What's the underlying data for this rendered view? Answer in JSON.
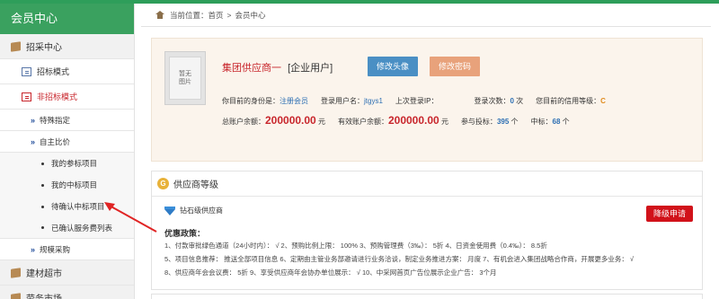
{
  "sidebar": {
    "title": "会员中心",
    "sections": [
      {
        "label": "招采中心",
        "icon": "box-icon"
      },
      {
        "label": "建材超市",
        "icon": "box-icon"
      },
      {
        "label": "劳务市场",
        "icon": "box-icon"
      }
    ],
    "items": [
      {
        "label": "招标模式",
        "icon": "document-icon"
      },
      {
        "label": "非招标模式",
        "icon": "document-icon"
      }
    ],
    "subitems": [
      {
        "label": "特殊指定"
      },
      {
        "label": "自主比价"
      },
      {
        "label": "规模采购"
      }
    ],
    "leaf_items": [
      {
        "label": "我的参标项目"
      },
      {
        "label": "我的中标项目"
      },
      {
        "label": "待确认中标项目"
      },
      {
        "label": "已确认服务费列表"
      }
    ]
  },
  "breadcrumb": {
    "prefix": "当前位置：",
    "home": "首页",
    "separator": ">",
    "current": "会员中心"
  },
  "profile": {
    "avatar_text": "暂无图片",
    "company_name": "集团供应商一",
    "company_type": "[企业用户]",
    "change_avatar_label": "修改头像",
    "change_password_label": "修改密码",
    "identity_label": "你目前的身份是：",
    "identity_value": "注册会员",
    "username_label": "登录用户名：",
    "username_value": "jtgys1",
    "last_ip_label": "上次登录IP：",
    "last_ip_value": "",
    "login_count_label": "登录次数：",
    "login_count_value": "0",
    "login_count_unit": "次",
    "credit_label": "您目前的信用等级：",
    "credit_value": "C",
    "total_balance_label": "总账户余额：",
    "total_balance_value": "200000.00",
    "total_balance_unit": "元",
    "valid_balance_label": "有效账户余额：",
    "valid_balance_value": "200000.00",
    "valid_balance_unit": "元",
    "bids_label": "参与投标：",
    "bids_value": "395",
    "bids_unit": "个",
    "won_label": "中标：",
    "won_value": "68",
    "won_unit": "个"
  },
  "level": {
    "badge": "G",
    "title": "供应商等级",
    "tier_name": "钻石级供应商",
    "downgrade_label": "降级申请",
    "policy_title": "优惠政策：",
    "policy_lines": [
      "1、付款审批绿色通道（24小时内）：  √      2、预购比例上限：  100%      3、预购管理费（3‰）：   5折      4、日资金使用费（0.4‰）：   8.5折",
      "5、项目信息推荐：  推送全部项目信息      6、定期由主管业务部邀请进行业务洽谈，制定业务推进方案：  月度      7、有机会进入集团战略合作商，开展更多业务：  √",
      "8、供应商年会会议费：    5折      9、享受供应商年会协办单位展示：  √      10、中采网首页广告位展示企业广告：    3个月"
    ]
  },
  "colors": {
    "brand_green": "#3aa15f",
    "accent_red": "#c8262c",
    "link_blue": "#2d6fb3",
    "button_blue": "#4a8fc4",
    "button_orange": "#e8a27b",
    "downgrade_red": "#d1121a"
  }
}
